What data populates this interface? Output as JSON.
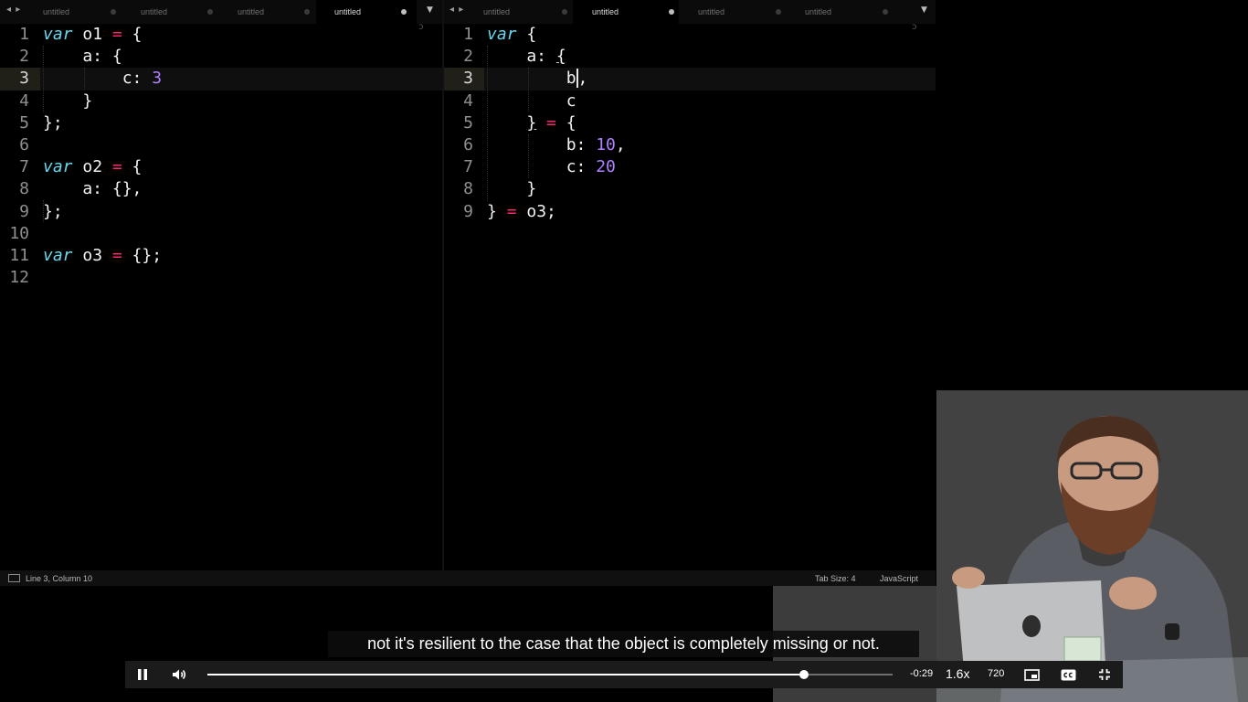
{
  "editor": {
    "left_pane": {
      "tabs": [
        {
          "label": "untitled",
          "active": false
        },
        {
          "label": "untitled",
          "active": false
        },
        {
          "label": "untitled",
          "active": false
        },
        {
          "label": "untitled",
          "active": true
        }
      ],
      "current_line": 3,
      "lines": [
        {
          "n": "1",
          "tokens": [
            {
              "t": "var",
              "c": "kw"
            },
            {
              "t": " o1 "
            },
            {
              "t": "=",
              "c": "op"
            },
            {
              "t": " {"
            }
          ]
        },
        {
          "n": "2",
          "tokens": [
            {
              "t": "    a: {"
            }
          ]
        },
        {
          "n": "3",
          "tokens": [
            {
              "t": "        c: "
            },
            {
              "t": "3",
              "c": "num"
            }
          ]
        },
        {
          "n": "4",
          "tokens": [
            {
              "t": "    }"
            }
          ]
        },
        {
          "n": "5",
          "tokens": [
            {
              "t": "};"
            }
          ]
        },
        {
          "n": "6",
          "tokens": []
        },
        {
          "n": "7",
          "tokens": [
            {
              "t": "var",
              "c": "kw"
            },
            {
              "t": " o2 "
            },
            {
              "t": "=",
              "c": "op"
            },
            {
              "t": " {"
            }
          ]
        },
        {
          "n": "8",
          "tokens": [
            {
              "t": "    a: {},"
            }
          ]
        },
        {
          "n": "9",
          "tokens": [
            {
              "t": "};"
            }
          ]
        },
        {
          "n": "10",
          "tokens": []
        },
        {
          "n": "11",
          "tokens": [
            {
              "t": "var",
              "c": "kw"
            },
            {
              "t": " o3 "
            },
            {
              "t": "=",
              "c": "op"
            },
            {
              "t": " {};"
            }
          ]
        },
        {
          "n": "12",
          "tokens": []
        }
      ]
    },
    "right_pane": {
      "tabs": [
        {
          "label": "untitled",
          "active": false
        },
        {
          "label": "untitled",
          "active": true
        },
        {
          "label": "untitled",
          "active": false
        },
        {
          "label": "untitled",
          "active": false
        }
      ],
      "current_line": 3,
      "lines": [
        {
          "n": "1",
          "tokens": [
            {
              "t": "var",
              "c": "kw"
            },
            {
              "t": " {"
            }
          ]
        },
        {
          "n": "2",
          "tokens": [
            {
              "t": "    a: "
            },
            {
              "t": "{",
              "c": "match"
            }
          ]
        },
        {
          "n": "3",
          "tokens": [
            {
              "t": "        "
            },
            {
              "t": "b",
              "c": "cursor"
            },
            {
              "t": ","
            }
          ]
        },
        {
          "n": "4",
          "tokens": [
            {
              "t": "        c"
            }
          ]
        },
        {
          "n": "5",
          "tokens": [
            {
              "t": "    "
            },
            {
              "t": "}",
              "c": "match"
            },
            {
              "t": " "
            },
            {
              "t": "=",
              "c": "op"
            },
            {
              "t": " {"
            }
          ]
        },
        {
          "n": "6",
          "tokens": [
            {
              "t": "        b: "
            },
            {
              "t": "10",
              "c": "num"
            },
            {
              "t": ","
            }
          ]
        },
        {
          "n": "7",
          "tokens": [
            {
              "t": "        c: "
            },
            {
              "t": "20",
              "c": "num"
            }
          ]
        },
        {
          "n": "8",
          "tokens": [
            {
              "t": "    }"
            }
          ]
        },
        {
          "n": "9",
          "tokens": [
            {
              "t": "} "
            },
            {
              "t": "=",
              "c": "op"
            },
            {
              "t": " o3;"
            }
          ]
        }
      ]
    },
    "status": {
      "position": "Line 3, Column 10",
      "tab_size": "Tab Size: 4",
      "syntax": "JavaScript"
    },
    "icons": {
      "tab_nav": "◂ ▸",
      "overflow": "▼",
      "minimap": "ↄ"
    }
  },
  "player": {
    "caption": "not it's resilient to the case that the object is completely missing or not.",
    "time_remaining": "-0:29",
    "speed": "1.6x",
    "quality": "720",
    "progress": 0.871,
    "icons": {
      "play_pause": "pause-icon",
      "volume": "volume-icon",
      "pip": "picture-in-picture-icon",
      "cc": "closed-captions-icon",
      "fullscreen": "exit-fullscreen-icon"
    }
  },
  "colors": {
    "keyword": "#66d9ef",
    "operator": "#f92672",
    "number": "#ae81ff",
    "text": "#f2f2f2",
    "background": "#000000"
  }
}
